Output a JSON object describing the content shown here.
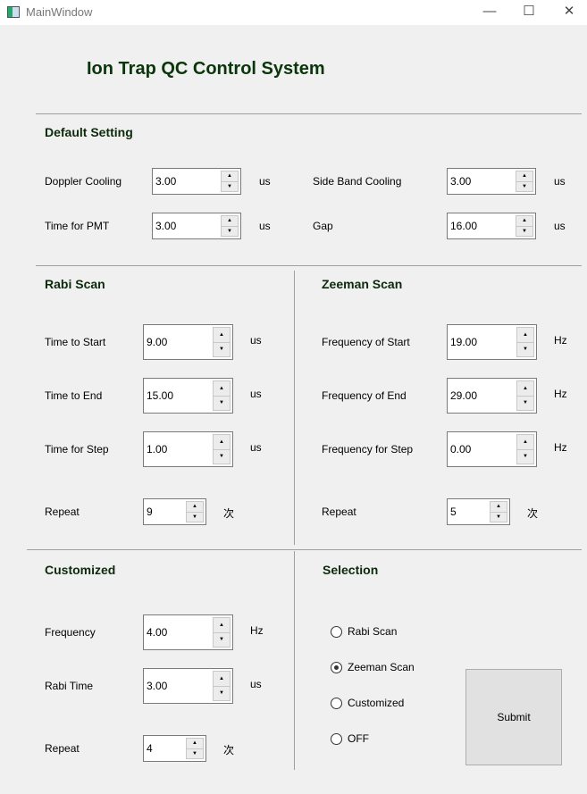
{
  "window": {
    "title": "MainWindow",
    "minimize": "—",
    "maximize": "☐",
    "close": "✕"
  },
  "title": "Ion Trap QC Control System",
  "default": {
    "heading": "Default Setting",
    "doppler": {
      "label": "Doppler Cooling",
      "value": "3.00",
      "unit": "us"
    },
    "sideband": {
      "label": "Side Band Cooling",
      "value": "3.00",
      "unit": "us"
    },
    "pmt": {
      "label": "Time for PMT",
      "value": "3.00",
      "unit": "us"
    },
    "gap": {
      "label": "Gap",
      "value": "16.00",
      "unit": "us"
    }
  },
  "rabi": {
    "heading": "Rabi Scan",
    "start": {
      "label": "Time to Start",
      "value": "9.00",
      "unit": "us"
    },
    "end": {
      "label": "Time to End",
      "value": "15.00",
      "unit": "us"
    },
    "step": {
      "label": "Time for Step",
      "value": "1.00",
      "unit": "us"
    },
    "repeat": {
      "label": "Repeat",
      "value": "9",
      "unit": "次"
    }
  },
  "zeeman": {
    "heading": "Zeeman Scan",
    "start": {
      "label": "Frequency of Start",
      "value": "19.00",
      "unit": "Hz"
    },
    "end": {
      "label": "Frequency of End",
      "value": "29.00",
      "unit": "Hz"
    },
    "step": {
      "label": "Frequency for Step",
      "value": "0.00",
      "unit": "Hz"
    },
    "repeat": {
      "label": "Repeat",
      "value": "5",
      "unit": "次"
    }
  },
  "custom": {
    "heading": "Customized",
    "freq": {
      "label": "Frequency",
      "value": "4.00",
      "unit": "Hz"
    },
    "rabitime": {
      "label": "Rabi Time",
      "value": "3.00",
      "unit": "us"
    },
    "repeat": {
      "label": "Repeat",
      "value": "4",
      "unit": "次"
    }
  },
  "selection": {
    "heading": "Selection",
    "options": [
      "Rabi Scan",
      "Zeeman Scan",
      "Customized",
      "OFF"
    ],
    "selected": 1,
    "submit": "Submit"
  },
  "spin": {
    "up": "▲",
    "down": "▼"
  }
}
